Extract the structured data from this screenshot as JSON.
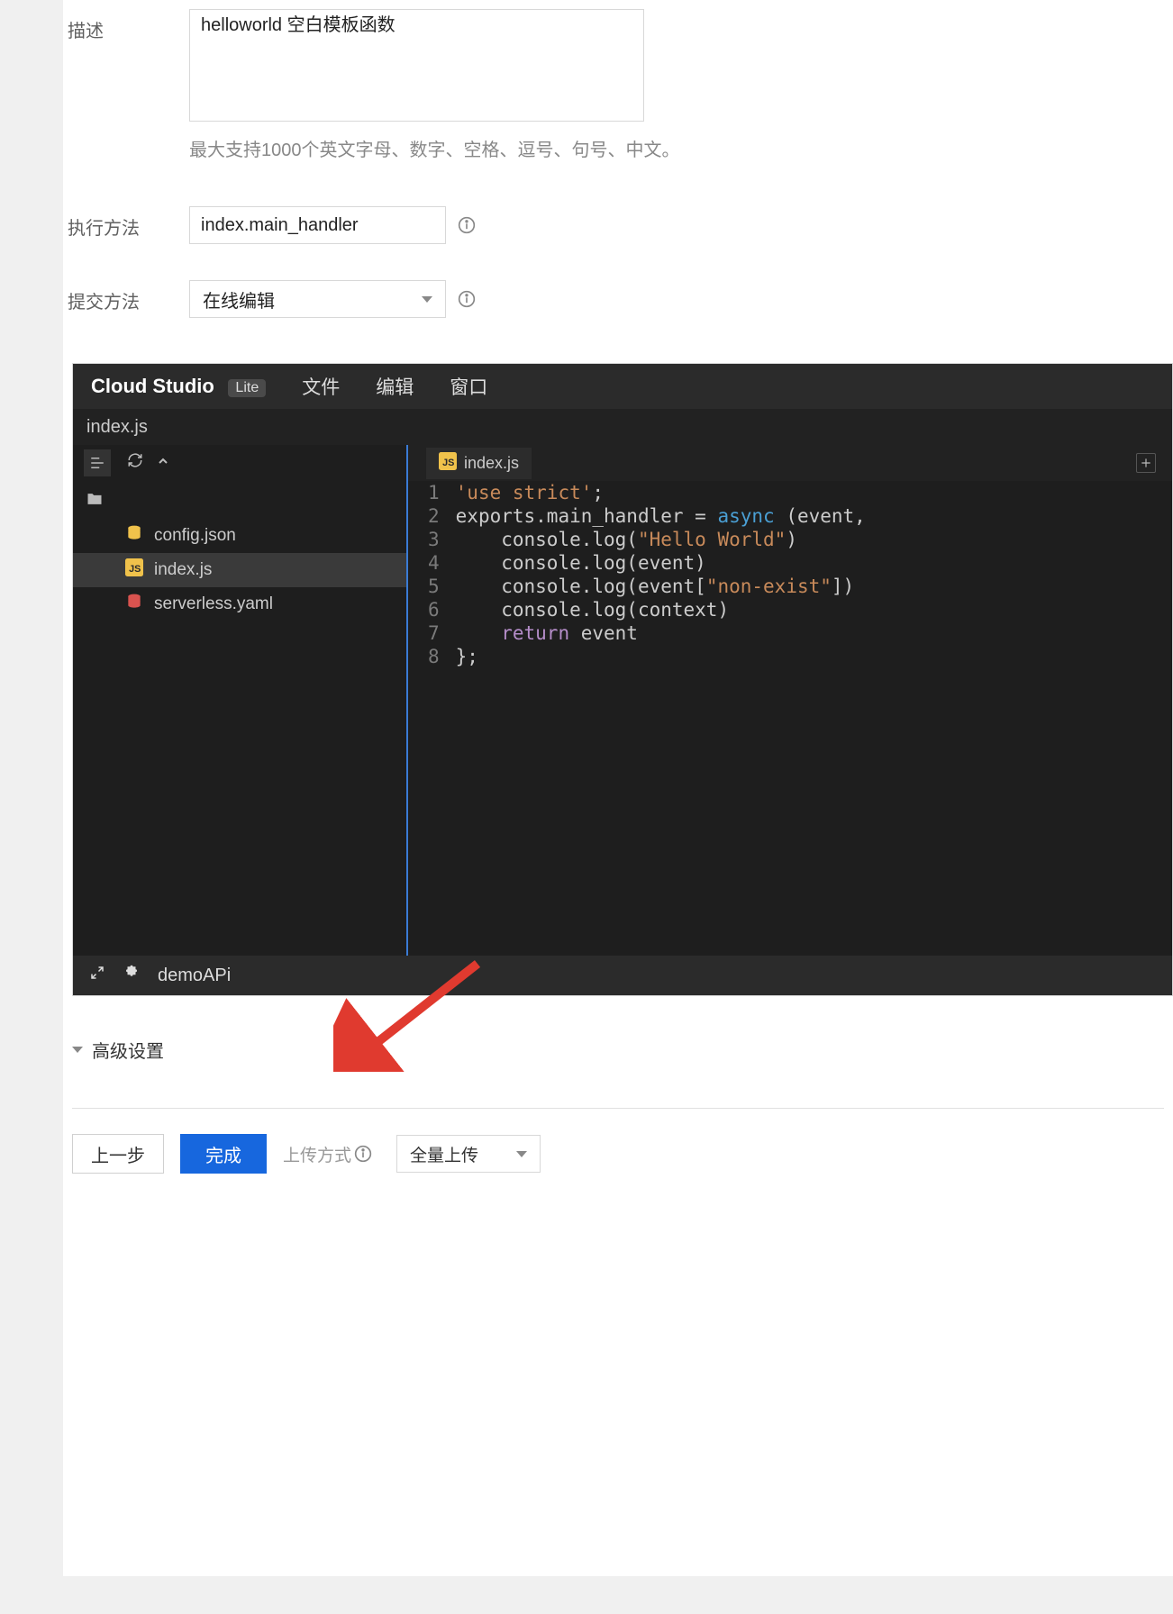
{
  "form": {
    "description": {
      "label": "描述",
      "value": "helloworld 空白模板函数",
      "hint": "最大支持1000个英文字母、数字、空格、逗号、句号、中文。"
    },
    "exec": {
      "label": "执行方法",
      "value": "index.main_handler"
    },
    "submit": {
      "label": "提交方法",
      "value": "在线编辑"
    }
  },
  "editor": {
    "brand": "Cloud Studio",
    "brand_badge": "Lite",
    "menus": {
      "file": "文件",
      "edit": "编辑",
      "window": "窗口"
    },
    "subbar_title": "index.js",
    "files": {
      "config": "config.json",
      "index": "index.js",
      "serverless": "serverless.yaml"
    },
    "tab": {
      "label": "index.js"
    },
    "code": {
      "line_numbers": [
        "1",
        "2",
        "3",
        "4",
        "5",
        "6",
        "7",
        "8"
      ],
      "l1_a": "'use strict'",
      "l1_b": ";",
      "l2_a": "exports.main_handler = ",
      "l2_b": "async",
      "l2_c": " (event,",
      "l3_a": "    console.log(",
      "l3_b": "\"Hello World\"",
      "l3_c": ")",
      "l4": "    console.log(event)",
      "l5_a": "    console.log(event[",
      "l5_b": "\"non-exist\"",
      "l5_c": "])",
      "l6": "    console.log(context)",
      "l7_a": "    ",
      "l7_b": "return",
      "l7_c": " event",
      "l8": "};"
    },
    "status": {
      "project": "demoAPi"
    }
  },
  "advanced_label": "高级设置",
  "footer": {
    "prev": "上一步",
    "finish": "完成",
    "upload_label": "上传方式",
    "upload_mode": "全量上传"
  }
}
